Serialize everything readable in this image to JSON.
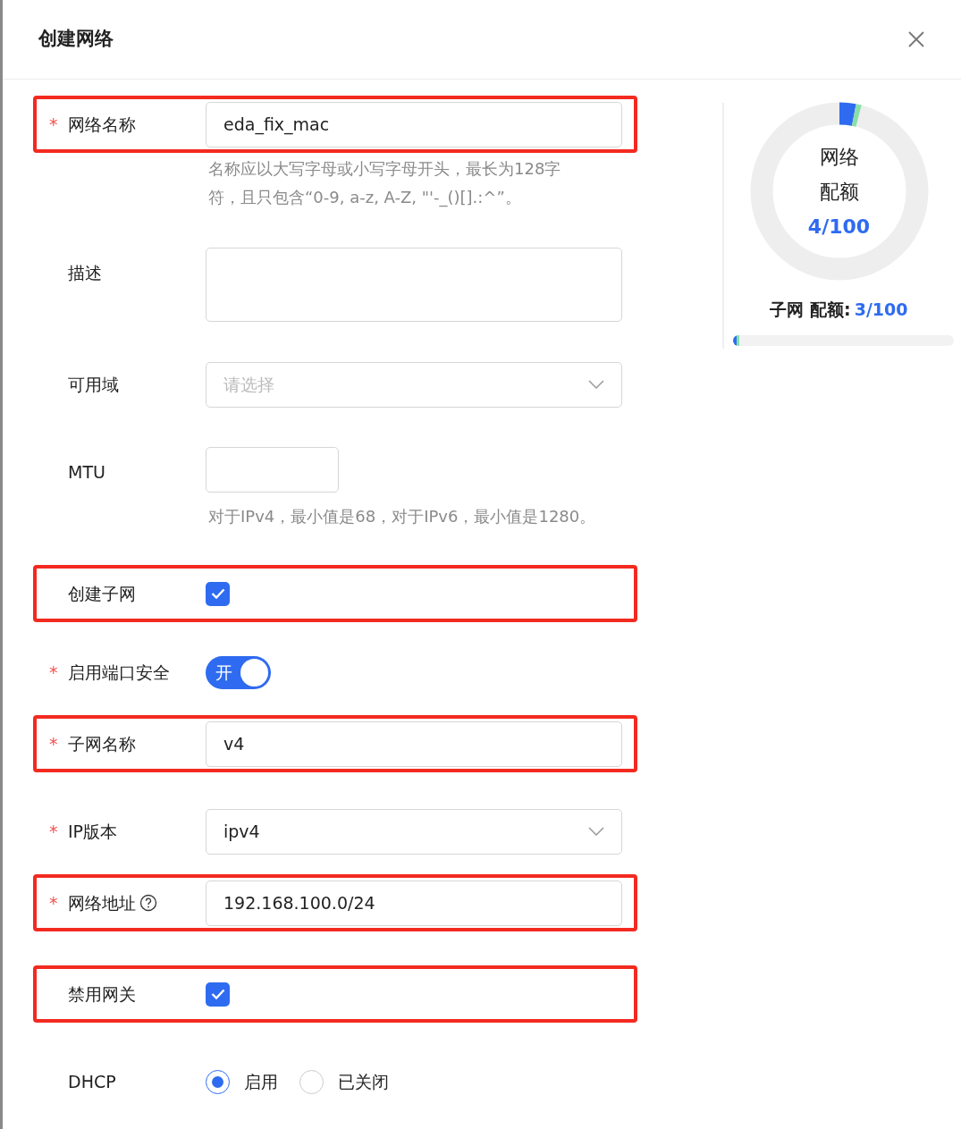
{
  "dialog": {
    "title": "创建网络"
  },
  "form": [
    {
      "kind": "input",
      "label": "网络名称",
      "required_mark": "*",
      "highlighted": true,
      "value": "eda_fix_mac",
      "hint": [
        "名称应以大写字母或小写字母开头，最长为128字",
        "符，且只包含“0-9, a-z, A-Z, \"'-_()[].:^”。"
      ]
    },
    {
      "kind": "textarea",
      "label": "描述",
      "highlighted": false
    },
    {
      "kind": "select",
      "label": "可用域",
      "highlighted": false,
      "placeholder": "请选择"
    },
    {
      "kind": "short-input",
      "label": "MTU",
      "highlighted": false,
      "hint": [
        "对于IPv4，最小值是68，对于IPv6，最小值是1280。"
      ]
    },
    {
      "kind": "checkbox",
      "label": "创建子网",
      "highlighted": true,
      "checked": true
    },
    {
      "kind": "switch",
      "label": "启用端口安全",
      "required_mark": "*",
      "highlighted": false,
      "on": true,
      "switch_text": "开"
    },
    {
      "kind": "input",
      "label": "子网名称",
      "required_mark": "*",
      "highlighted": true,
      "value": "v4"
    },
    {
      "kind": "select",
      "label": "IP版本",
      "required_mark": "*",
      "highlighted": false,
      "value": "ipv4"
    },
    {
      "kind": "input",
      "label": "网络地址",
      "required_mark": "*",
      "highlighted": true,
      "help": true,
      "value": "192.168.100.0/24"
    },
    {
      "kind": "checkbox",
      "label": "禁用网关",
      "highlighted": true,
      "checked": true
    },
    {
      "kind": "radio",
      "label": "DHCP",
      "highlighted": false,
      "options": [
        {
          "label": "启用",
          "selected": true
        },
        {
          "label": "已关闭",
          "selected": false
        }
      ]
    }
  ],
  "quota": {
    "network": {
      "title_lines": [
        "网络",
        "配额"
      ],
      "reading": "4/100",
      "segments": [
        {
          "level": 0.03,
          "color": "#2f6bf0"
        },
        {
          "level": 0.01,
          "color": "#86e0a8"
        }
      ]
    },
    "subnet": {
      "label": "子网 配额:",
      "reading": "3/100",
      "segments": [
        {
          "level": 0.015,
          "color": "#2f6bf0"
        },
        {
          "level": 0.005,
          "color": "#86e0a8"
        }
      ]
    }
  }
}
